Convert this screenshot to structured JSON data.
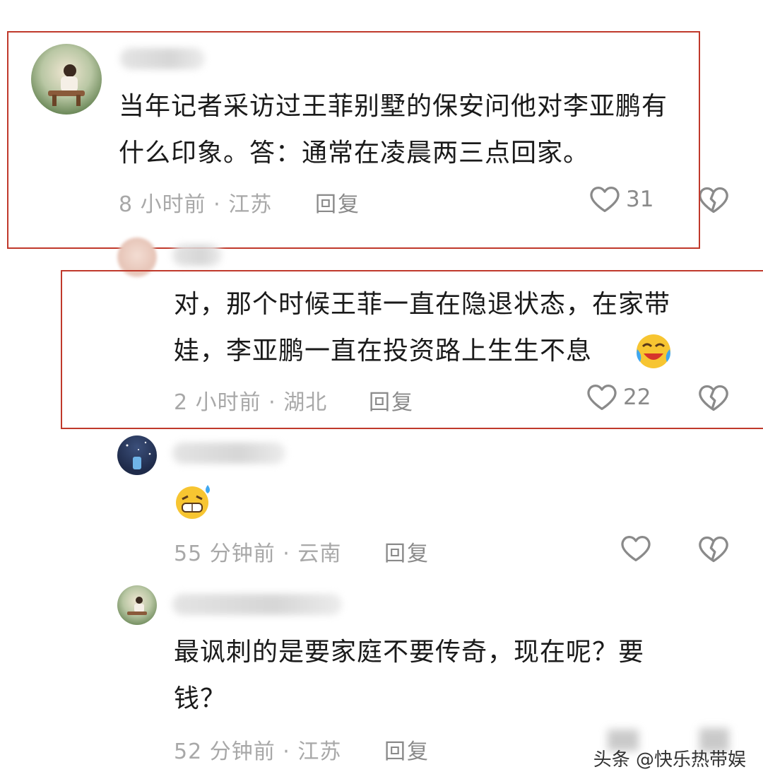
{
  "comments": [
    {
      "text_line1": "当年记者采访过王菲别墅的保安问他对李亚鹏有",
      "text_line2": "什么印象。答：通常在凌晨两三点回家。",
      "meta": "8 小时前 · 江苏",
      "reply_label": "回复",
      "likes": "31"
    },
    {
      "text_line1": "对，那个时候王菲一直在隐退状态，在家带",
      "text_line2": "娃，李亚鹏一直在投资路上生生不息",
      "emoji": "crying-laughing-emoji",
      "meta": "2 小时前 · 湖北",
      "reply_label": "回复",
      "likes": "22"
    },
    {
      "emoji": "sweat-grin-emoji",
      "meta": "55 分钟前 · 云南",
      "reply_label": "回复"
    },
    {
      "text_line1": "最讽刺的是要家庭不要传奇，现在呢？要",
      "text_line2": "钱？",
      "meta": "52 分钟前 · 江苏",
      "reply_label": "回复"
    }
  ],
  "watermark": "头条 @快乐热带娱",
  "colors": {
    "highlight_box": "#c0392b",
    "meta_text": "#a8a8a8",
    "body_text": "#1a1a1a"
  },
  "icons": [
    "heart-outline-icon",
    "broken-heart-icon"
  ]
}
